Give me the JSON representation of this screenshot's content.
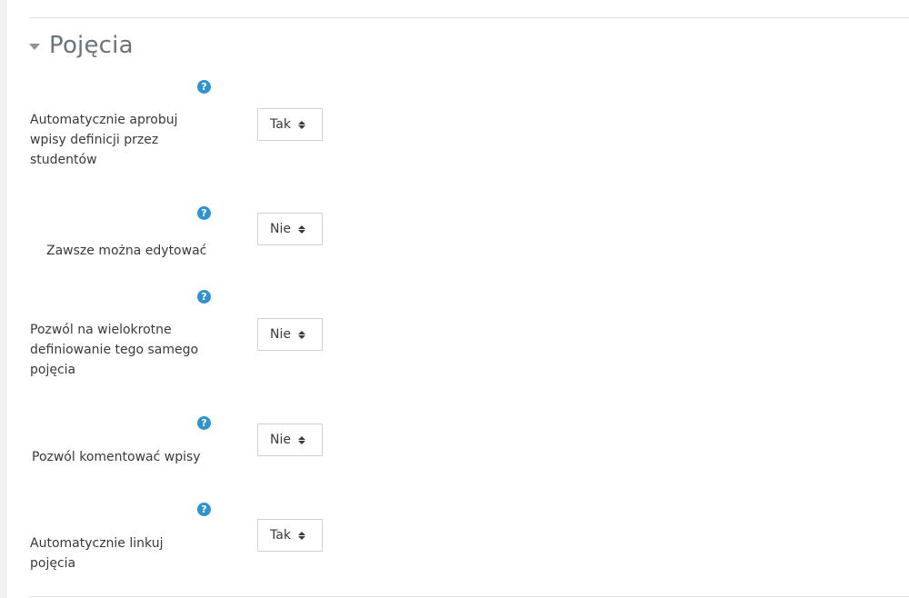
{
  "section": {
    "title": "Pojęcia",
    "expanded": true
  },
  "help_icon_glyph": "?",
  "accent_color": "#2f93d1",
  "settings": [
    {
      "label": "Automatycznie aprobuj wpisy definicji przez studentów",
      "value": "Tak"
    },
    {
      "label": "Zawsze można edytować",
      "value": "Nie"
    },
    {
      "label": "Pozwól na wielokrotne definiowanie tego samego pojęcia",
      "value": "Nie"
    },
    {
      "label": "Pozwól komentować wpisy",
      "value": "Nie"
    },
    {
      "label": "Automatycznie linkuj pojęcia",
      "value": "Tak"
    }
  ]
}
